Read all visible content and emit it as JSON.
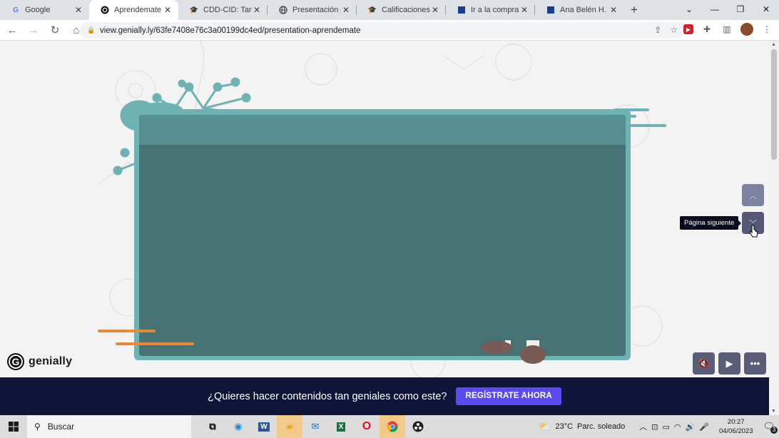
{
  "browser": {
    "tabs": [
      {
        "title": "Google",
        "icon": "google-icon",
        "active": false
      },
      {
        "title": "Aprendemate",
        "icon": "genially-icon",
        "active": true
      },
      {
        "title": "CDD-CID: Tarea p",
        "icon": "moodle-cap-icon",
        "active": false
      },
      {
        "title": "Presentación de",
        "icon": "globe-icon",
        "active": false
      },
      {
        "title": "Calificaciones: Co",
        "icon": "moodle-cap-icon",
        "active": false
      },
      {
        "title": "Ir a la compra | M",
        "icon": "clapper-icon",
        "active": false
      },
      {
        "title": "Ana Belén H. | Mi",
        "icon": "clapper-icon",
        "active": false
      }
    ],
    "url": "view.genially.ly/63fe7408e76c3a00199dc4ed/presentation-aprendemate"
  },
  "presentation": {
    "tooltip": "Página siguiente",
    "logo_text": "genially"
  },
  "banner": {
    "question": "¿Quieres hacer contenidos tan geniales como este?",
    "cta": "REGÍSTRATE AHORA"
  },
  "taskbar": {
    "search_placeholder": "Buscar",
    "weather_temp": "23°C",
    "weather_text": "Parc. soleado",
    "time": "20:27",
    "date": "04/06/2023",
    "notifications": "3"
  },
  "colors": {
    "frame": "#6fb2b3",
    "screen": "#467274",
    "screen_band": "#578f92",
    "accent_orange": "#e8893a",
    "banner_bg": "#0e1538",
    "cta_bg": "#5b4af0"
  }
}
